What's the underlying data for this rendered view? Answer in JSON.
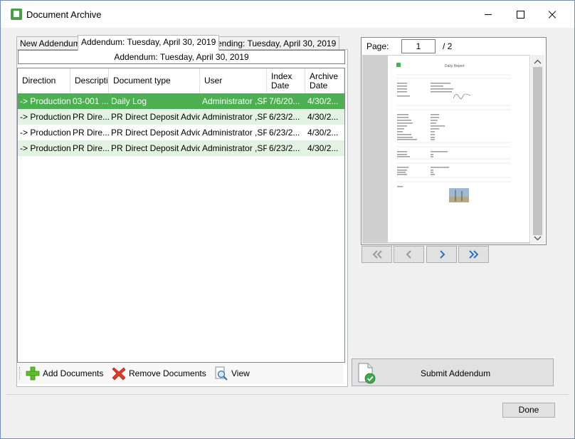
{
  "window": {
    "title": "Document Archive",
    "controls": [
      "minimize",
      "maximize",
      "close"
    ]
  },
  "tabs": [
    {
      "label": "New Addendum",
      "active": false
    },
    {
      "label": "Addendum: Tuesday, April 30, 2019",
      "active": true
    },
    {
      "label": "Pending: Tuesday, April 30, 2019",
      "active": false
    }
  ],
  "addendum_header": "Addendum: Tuesday, April 30, 2019",
  "grid": {
    "columns": [
      {
        "label": "Direction"
      },
      {
        "label": "Descriptic"
      },
      {
        "label": "Document type"
      },
      {
        "label": "User"
      },
      {
        "label": "Index Date"
      },
      {
        "label": "Archive Date"
      }
    ],
    "rows": [
      {
        "direction": "-> Production",
        "description": "03-001 ...",
        "doc_type": "Daily Log",
        "user": "Administrator ,SPC",
        "index_date": "7/6/20...",
        "archive_date": "4/30/2...",
        "state": "selected"
      },
      {
        "direction": "-> Production",
        "description": "PR Dire...",
        "doc_type": "PR Direct Deposit Advice",
        "user": "Administrator ,SPC",
        "index_date": "6/23/2...",
        "archive_date": "4/30/2...",
        "state": "alt"
      },
      {
        "direction": "-> Production",
        "description": "PR Dire...",
        "doc_type": "PR Direct Deposit Advice",
        "user": "Administrator ,SPC",
        "index_date": "6/23/2...",
        "archive_date": "4/30/2...",
        "state": "plain"
      },
      {
        "direction": "-> Production",
        "description": "PR Dire...",
        "doc_type": "PR Direct Deposit Advice",
        "user": "Administrator ,SPC",
        "index_date": "6/23/2...",
        "archive_date": "4/30/2...",
        "state": "alt"
      }
    ]
  },
  "toolbar": {
    "add": {
      "label": "Add Documents",
      "icon": "plus-icon"
    },
    "remove": {
      "label": "Remove Documents",
      "icon": "x-icon"
    },
    "view": {
      "label": "View",
      "icon": "magnifier-icon"
    }
  },
  "preview": {
    "page_label": "Page:",
    "page_value": "1",
    "page_total": "/ 2",
    "doc_title": "Daily Report"
  },
  "nav": [
    "first-page",
    "previous-page",
    "next-page",
    "last-page"
  ],
  "submit": {
    "label": "Submit Addendum"
  },
  "done": {
    "label": "Done"
  },
  "colors": {
    "accent_green": "#4caf50",
    "row_alt": "#e3f3e3"
  }
}
